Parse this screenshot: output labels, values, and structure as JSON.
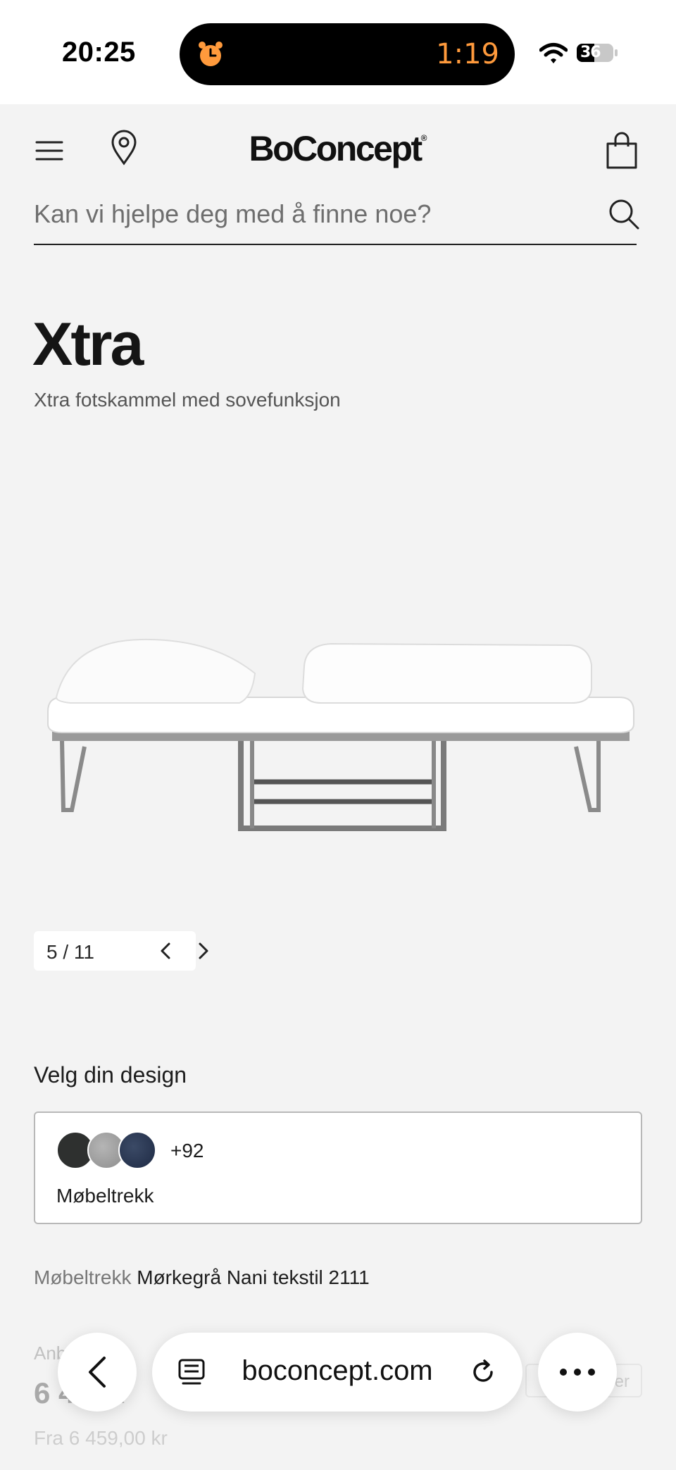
{
  "status_bar": {
    "time": "20:25",
    "timer": "1:19",
    "battery": "36"
  },
  "header": {
    "logo": "BoConcept",
    "logo_mark": "®",
    "search_placeholder": "Kan vi hjelpe deg med å finne noe?"
  },
  "product": {
    "title": "Xtra",
    "subtitle": "Xtra fotskammel med sovefunksjon",
    "image_icon": "sofa-bed-image"
  },
  "gallery": {
    "pager_text": "5 / 11",
    "current": 5,
    "total": 11
  },
  "design": {
    "heading": "Velg din design",
    "swatch_colors": [
      "#2e302f",
      "#a3a3a3",
      "#2a3856"
    ],
    "swatch_count": "+92",
    "label": "Møbeltrekk",
    "fabric_key": "Møbeltrekk",
    "fabric_value": "Mørkegrå Nani tekstil 2111"
  },
  "faded": {
    "note": "Anb        ilec",
    "price": "6 4      0 k",
    "from_price": "Fra 6 459,00 kr",
    "button": "er"
  },
  "browser": {
    "url": "boconcept.com"
  }
}
